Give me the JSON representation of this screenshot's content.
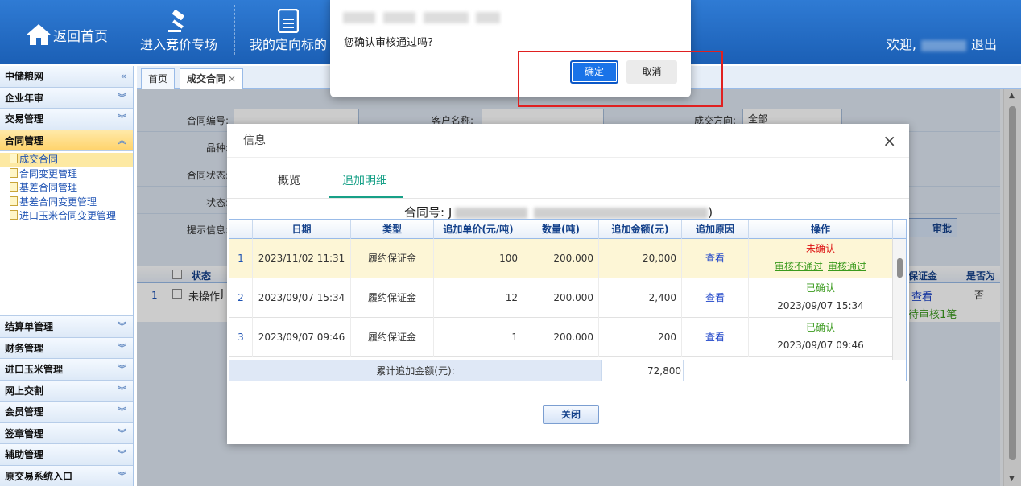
{
  "header": {
    "home_label": "返回首页",
    "nav": [
      {
        "label": "进入竞价专场",
        "icon": "gavel-icon"
      },
      {
        "label": "我的定向标的",
        "icon": "document-icon"
      }
    ],
    "welcome": "欢迎,",
    "logout": "退出"
  },
  "sidebar": {
    "items": [
      {
        "label": "中储粮网",
        "chev": "«"
      },
      {
        "label": "企业年审",
        "chev": "︾"
      },
      {
        "label": "交易管理",
        "chev": "︾"
      },
      {
        "label": "合同管理",
        "chev": "︽"
      }
    ],
    "subitems": [
      "成交合同",
      "合同变更管理",
      "基差合同管理",
      "基差合同变更管理",
      "进口玉米合同变更管理"
    ],
    "items_bottom": [
      "结算单管理",
      "财务管理",
      "进口玉米管理",
      "网上交割",
      "会员管理",
      "签章管理",
      "辅助管理",
      "原交易系统入口"
    ],
    "chev_down": "︾"
  },
  "tabs": [
    {
      "label": "首页"
    },
    {
      "label": "成交合同",
      "close": "×"
    }
  ],
  "form": {
    "labels": [
      "合同编号:",
      "客户名称:",
      "成交方向:",
      "品种:",
      "合同状态:",
      "状态:",
      "提示信息:"
    ],
    "direction_value": "全部",
    "approve_button": "审批"
  },
  "bg_table": {
    "headers": [
      "状态",
      "保证金",
      "是否为"
    ],
    "row": {
      "index": "1",
      "status": "未操作",
      "prefix": "J",
      "deposit": "查看",
      "pending": "待审核1笔",
      "flag": "否"
    }
  },
  "modal": {
    "title": "信息",
    "close": "×",
    "tabs": [
      "概览",
      "追加明细"
    ],
    "contract_label": "合同号: J",
    "contract_suffix": ")",
    "columns": [
      "日期",
      "类型",
      "追加单价(元/吨)",
      "数量(吨)",
      "追加金额(元)",
      "追加原因",
      "操作"
    ],
    "rows": [
      {
        "idx": "1",
        "date": "2023/11/02 11:31",
        "type": "履约保证金",
        "price": "100",
        "qty": "200.000",
        "amount": "20,000",
        "reason": "查看",
        "status": "未确认",
        "action1": "审核不通过",
        "action2": "审核通过"
      },
      {
        "idx": "2",
        "date": "2023/09/07 15:34",
        "type": "履约保证金",
        "price": "12",
        "qty": "200.000",
        "amount": "2,400",
        "reason": "查看",
        "status": "已确认",
        "time": "2023/09/07 15:34"
      },
      {
        "idx": "3",
        "date": "2023/09/07 09:46",
        "type": "履约保证金",
        "price": "1",
        "qty": "200.000",
        "amount": "200",
        "reason": "查看",
        "status": "已确认",
        "time": "2023/09/07 09:46"
      }
    ],
    "sum_label": "累计追加金额(元):",
    "sum_value": "72,800",
    "close_button": "关闭"
  },
  "confirm": {
    "message": "您确认审核通过吗?",
    "ok": "确定",
    "cancel": "取消"
  },
  "colors": {
    "header": "#2f7bd4",
    "ok": "#1a73e8",
    "accent": "#17a087",
    "highlight_box": "#e02020"
  }
}
